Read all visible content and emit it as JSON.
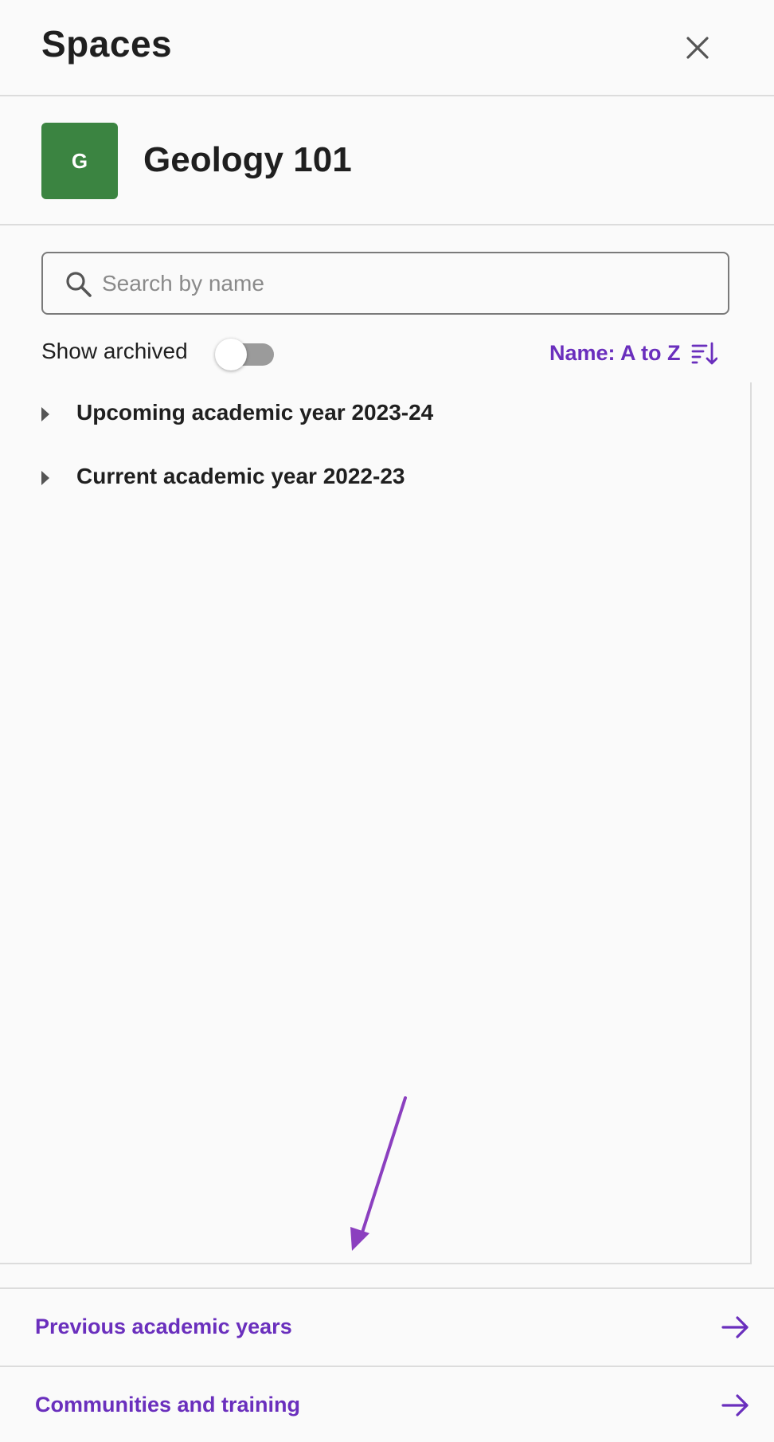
{
  "header": {
    "title": "Spaces"
  },
  "space": {
    "avatar_letter": "G",
    "name": "Geology 101",
    "avatar_color": "#3b8441"
  },
  "search": {
    "placeholder": "Search by name",
    "value": ""
  },
  "filters": {
    "show_archived_label": "Show archived",
    "show_archived_on": false
  },
  "sort": {
    "label": "Name: A to Z"
  },
  "tree": {
    "items": [
      {
        "label": "Upcoming academic year 2023-24",
        "expanded": false
      },
      {
        "label": "Current academic year 2022-23",
        "expanded": false
      }
    ]
  },
  "footer": {
    "links": [
      {
        "label": "Previous academic years"
      },
      {
        "label": "Communities and training"
      }
    ]
  },
  "colors": {
    "accent": "#6a2fbd",
    "annotation": "#8b3fbf",
    "border": "#dcdcdc"
  },
  "icons": {
    "close": "close-icon",
    "search": "search-icon",
    "sort": "sort-descending-icon",
    "caret": "caret-right-icon",
    "arrow": "arrow-right-icon"
  }
}
